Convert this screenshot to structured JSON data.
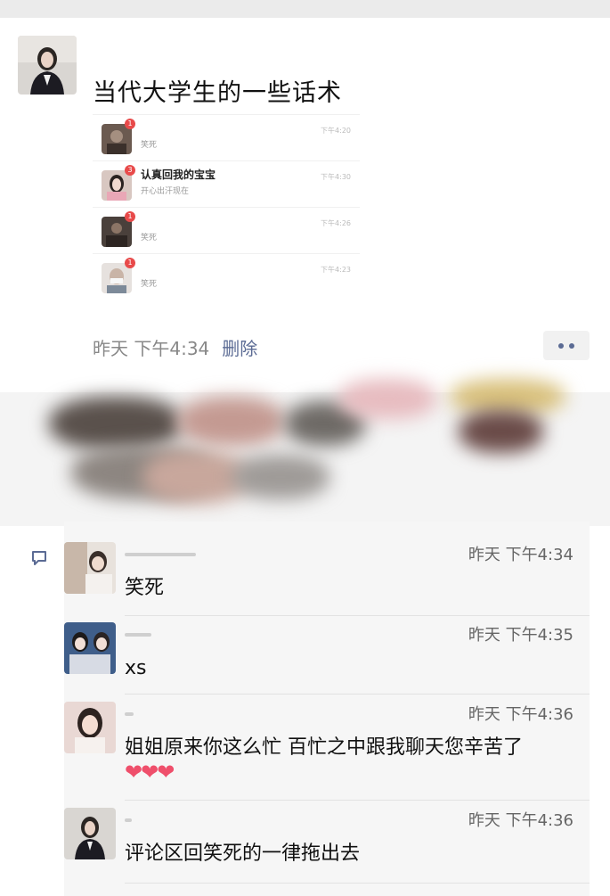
{
  "post": {
    "text": "当代大学生的一些话术",
    "embedded_screenshot": {
      "items": [
        {
          "title": "",
          "subtitle": "笑死",
          "time": "下午4:20",
          "badge": "1"
        },
        {
          "title": "认真回我的宝宝",
          "subtitle": "开心出汗现在",
          "time": "下午4:30",
          "badge": "3"
        },
        {
          "title": "",
          "subtitle": "笑死",
          "time": "下午4:26",
          "badge": "1"
        },
        {
          "title": "",
          "subtitle": "笑死",
          "time": "下午4:23",
          "badge": "1"
        }
      ]
    },
    "timestamp": "昨天 下午4:34",
    "delete_label": "删除"
  },
  "comments": [
    {
      "text": "笑死",
      "time": "昨天 下午4:34"
    },
    {
      "text": "xs",
      "time": "昨天 下午4:35"
    },
    {
      "text": "姐姐原来你这么忙 百忙之中跟我聊天您辛苦了",
      "time": "昨天 下午4:36"
    },
    {
      "text": "评论区回笑死的一律拖出去",
      "time": "昨天 下午4:36"
    }
  ],
  "hearts": "❤❤❤",
  "colors": {
    "link": "#5b6b94",
    "heart": "#ef4f6b",
    "badge": "#e84a4a"
  }
}
